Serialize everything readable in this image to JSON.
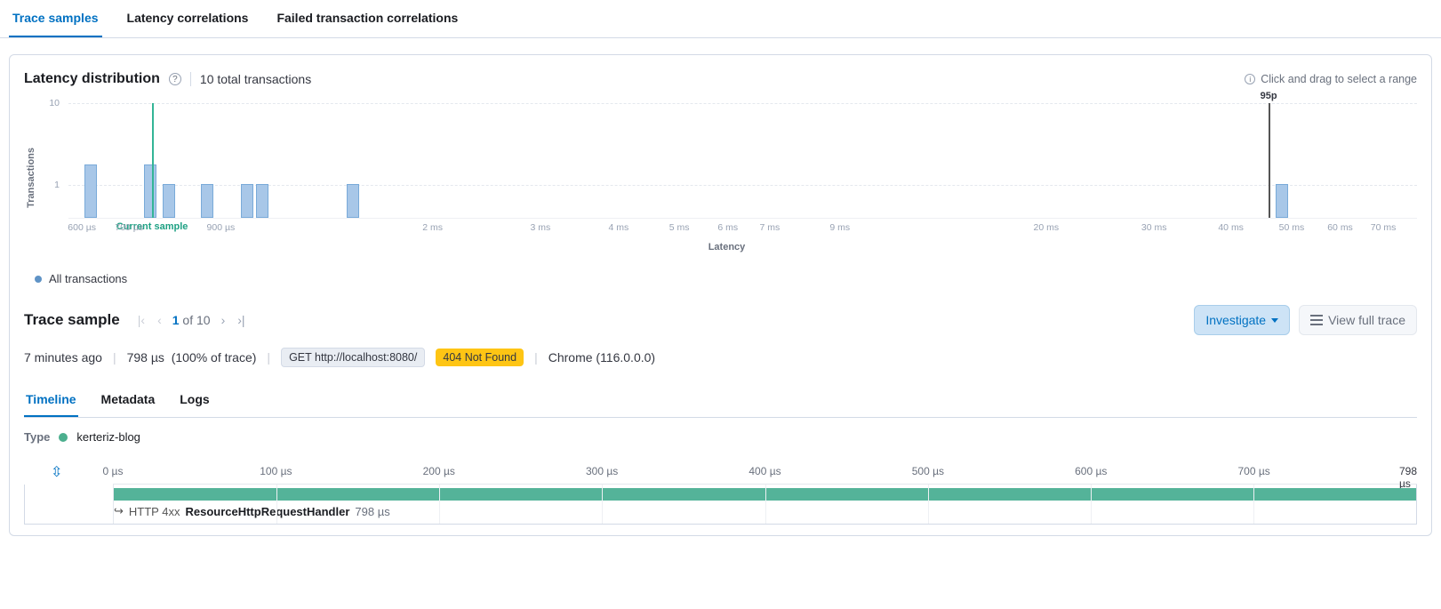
{
  "top_tabs": {
    "trace_samples": "Trace samples",
    "latency_corr": "Latency correlations",
    "failed_corr": "Failed transaction correlations"
  },
  "latency": {
    "title": "Latency distribution",
    "total": "10 total transactions",
    "hint": "Click and drag to select a range",
    "yaxis_title": "Transactions",
    "xaxis_title": "Latency",
    "legend": "All transactions",
    "current_sample_label": "Current sample",
    "p95_label": "95p"
  },
  "chart_data": {
    "type": "bar",
    "ylabel": "Transactions",
    "xlabel": "Latency",
    "y_ticks": [
      1,
      10
    ],
    "x_ticks": [
      "600 µs",
      "700 µs",
      "",
      "900 µs",
      "",
      "",
      "",
      "",
      "",
      "",
      "",
      "2 ms",
      "",
      "3 ms",
      "",
      "4 ms",
      "",
      "5 ms",
      "6 ms",
      "7 ms",
      "",
      "9 ms",
      "",
      "",
      "",
      "",
      "20 ms",
      "",
      "",
      "30 ms",
      "",
      "",
      "40 ms",
      "",
      "50 ms",
      "",
      "60 ms",
      "",
      "70 ms"
    ],
    "x_tick_positions_pct": [
      0,
      3.5,
      7,
      10.5,
      14,
      17.5,
      21,
      24.5,
      28,
      31.5,
      35,
      38.5
    ],
    "bars": [
      {
        "x_pct": 1.2,
        "value": 2
      },
      {
        "x_pct": 5.6,
        "value": 2
      },
      {
        "x_pct": 7.0,
        "value": 1
      },
      {
        "x_pct": 9.8,
        "value": 1
      },
      {
        "x_pct": 12.8,
        "value": 1
      },
      {
        "x_pct": 13.9,
        "value": 1
      },
      {
        "x_pct": 20.6,
        "value": 1
      },
      {
        "x_pct": 89.5,
        "value": 1
      }
    ],
    "markers": {
      "current_sample_pct": 6.2,
      "p95_pct": 89.0
    },
    "xaxis_labels": [
      {
        "pct": 1.0,
        "label": "600 µs"
      },
      {
        "pct": 4.5,
        "label": "700 µs"
      },
      {
        "pct": 11.3,
        "label": "900 µs"
      },
      {
        "pct": 27.0,
        "label": "2 ms"
      },
      {
        "pct": 35.0,
        "label": "3 ms"
      },
      {
        "pct": 40.8,
        "label": "4 ms"
      },
      {
        "pct": 45.3,
        "label": "5 ms"
      },
      {
        "pct": 48.9,
        "label": "6 ms"
      },
      {
        "pct": 52.0,
        "label": "7 ms"
      },
      {
        "pct": 57.2,
        "label": "9 ms"
      },
      {
        "pct": 72.5,
        "label": "20 ms"
      },
      {
        "pct": 80.5,
        "label": "30 ms"
      },
      {
        "pct": 86.2,
        "label": "40 ms"
      },
      {
        "pct": 90.7,
        "label": "50 ms"
      },
      {
        "pct": 94.3,
        "label": "60 ms"
      },
      {
        "pct": 97.5,
        "label": "70 ms"
      }
    ]
  },
  "trace": {
    "title": "Trace sample",
    "page_current": "1",
    "page_of": "of",
    "page_total": "10",
    "investigate": "Investigate",
    "view_full": "View full trace",
    "age": "7 minutes ago",
    "duration": "798 µs",
    "pct_trace": "(100% of trace)",
    "http_pill": "GET http://localhost:8080/",
    "status_pill": "404 Not Found",
    "browser": "Chrome (116.0.0.0)"
  },
  "sub_tabs": {
    "timeline": "Timeline",
    "metadata": "Metadata",
    "logs": "Logs"
  },
  "type_row": {
    "label": "Type",
    "service": "kerteriz-blog"
  },
  "timeline": {
    "ticks": [
      {
        "pct": 0,
        "label": "0 µs"
      },
      {
        "pct": 12.5,
        "label": "100 µs"
      },
      {
        "pct": 25,
        "label": "200 µs"
      },
      {
        "pct": 37.5,
        "label": "300 µs"
      },
      {
        "pct": 50,
        "label": "400 µs"
      },
      {
        "pct": 62.5,
        "label": "500 µs"
      },
      {
        "pct": 75,
        "label": "600 µs"
      },
      {
        "pct": 87.5,
        "label": "700 µs"
      }
    ],
    "total": "798 µs",
    "span": {
      "http": "HTTP 4xx",
      "name": "ResourceHttpRequestHandler",
      "dur": "798 µs"
    }
  }
}
